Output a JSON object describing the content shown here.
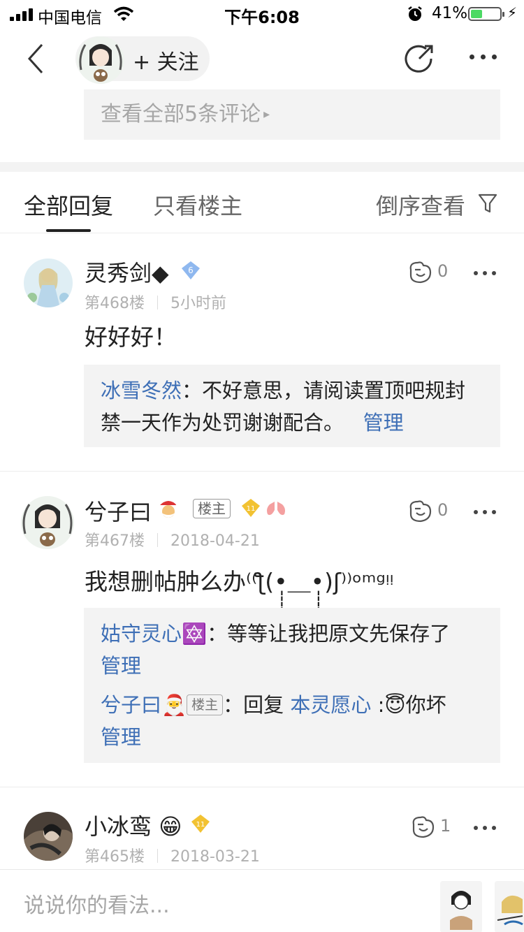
{
  "status_bar": {
    "carrier": "中国电信",
    "time": "下午6:08",
    "battery_percent": "41%",
    "battery_level": 0.41
  },
  "nav": {
    "follow_label": "+ 关注"
  },
  "view_all": {
    "label": "查看全部5条评论"
  },
  "tabs": {
    "all": "全部回复",
    "owner_only": "只看楼主",
    "sort": "倒序查看"
  },
  "posts": [
    {
      "username": "灵秀剑◆",
      "level": "6",
      "floor": "第468楼",
      "time": "5小时前",
      "likes": "0",
      "content": "好好好！",
      "replies": [
        {
          "author": "冰雪冬然",
          "text": "：不好意思，请阅读置顶吧规封禁一天作为处罚谢谢配合。",
          "manage": "管理"
        }
      ]
    },
    {
      "username": "兮子曰",
      "owner_tag": "楼主",
      "level": "11",
      "floor": "第467楼",
      "time": "2018-04-21",
      "likes": "0",
      "content": "我想删帖肿么办⁽⁽ƪ(•̩̩̩̩＿•̩̩̩̩)ʃ⁾⁾ᵒᵐᵍᵎᵎ",
      "replies": [
        {
          "author": "姑守灵心",
          "emoji": "🔯",
          "text": "：等等让我把原文先保存了",
          "manage": "管理"
        },
        {
          "author": "兮子曰",
          "owner_tag": "楼主",
          "prefix": "：回复",
          "mention": "本灵愿心",
          "text": ":😇你坏",
          "manage": "管理"
        }
      ]
    },
    {
      "username": "小冰鸾",
      "emoji": "😁",
      "level": "11",
      "floor": "第465楼",
      "time": "2018-03-21",
      "likes": "1"
    }
  ],
  "bottom": {
    "placeholder": "说说你的看法..."
  }
}
